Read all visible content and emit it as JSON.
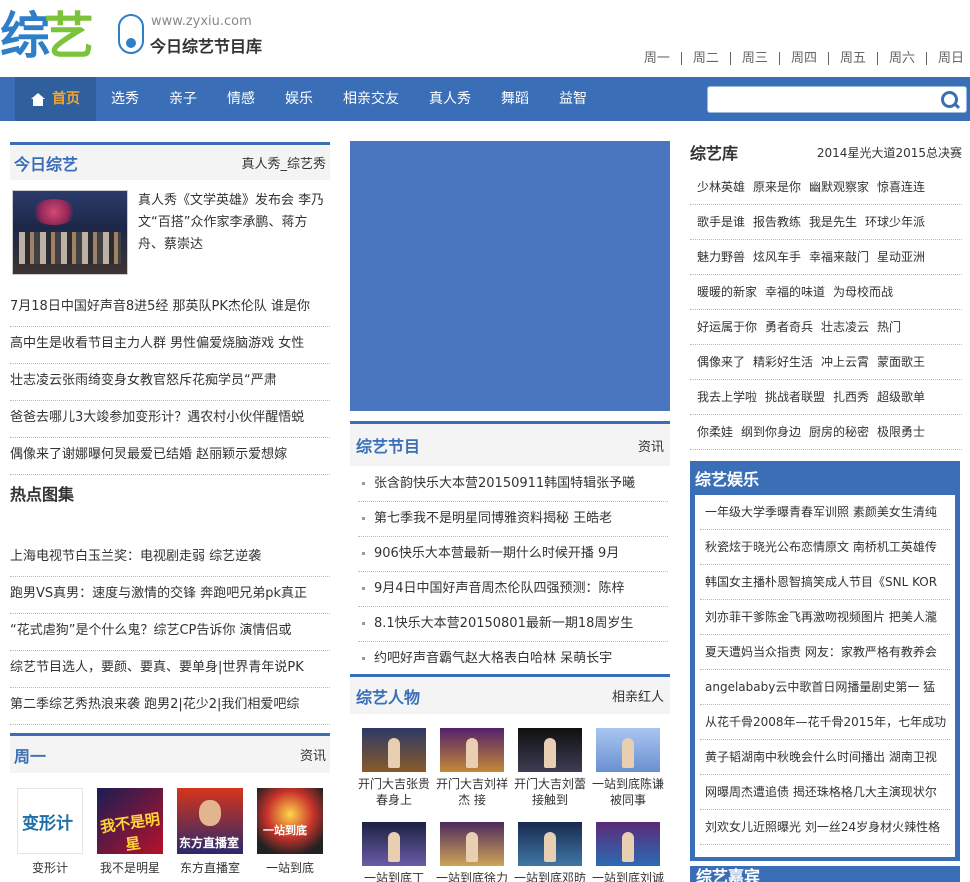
{
  "header": {
    "logo_text_1": "综",
    "logo_text_2": "艺",
    "url": "www.zyxiu.com",
    "site_name": "今日综艺节目库",
    "weekdays": [
      "周一",
      "周二",
      "周三",
      "周四",
      "周五",
      "周六",
      "周日"
    ]
  },
  "nav": {
    "home": "首页",
    "items": [
      "选秀",
      "亲子",
      "情感",
      "娱乐",
      "相亲交友",
      "真人秀",
      "舞蹈",
      "益智"
    ],
    "search_placeholder": ""
  },
  "today": {
    "title": "今日综艺",
    "more": "真人秀_综艺秀",
    "feature_text": "真人秀《文学英雄》发布会 李乃文“百搭”众作家李承鹏、蒋方舟、蔡崇达",
    "news": [
      "7月18日中国好声音8进5经 那英队PK杰伦队 谁是你",
      "高中生是收看节目主力人群 男性偏爱烧脑游戏 女性",
      "壮志凌云张雨绮变身女教官怒斥花痴学员“严肃",
      "爸爸去哪儿3大竣参加变形计？遇农村小伙伴醒悟蜕",
      "偶像来了谢娜曝何炅最爱已结婚 赵丽颖示爱想嫁"
    ]
  },
  "hot": {
    "title": "热点图集",
    "items": [
      "上海电视节白玉兰奖：电视剧走弱 综艺逆袭",
      "跑男VS真男：速度与激情的交锋 奔跑吧兄弟pk真正",
      "“花式虐狗”是个什么鬼？综艺CP告诉你 演情侣或",
      "综艺节目选人，要颜、要真、要单身|世界青年说PK",
      "第二季综艺秀热浪来袭 跑男2|花少2|我们相爱吧综"
    ]
  },
  "monday": {
    "title": "周一",
    "more": "资讯",
    "shows": [
      {
        "name": "变形计",
        "thumb_text": "变形计"
      },
      {
        "name": "我不是明星",
        "thumb_text": "我不是明星"
      },
      {
        "name": "东方直播室",
        "thumb_text": "东方直播室"
      },
      {
        "name": "一站到底",
        "thumb_text": "一站到底"
      }
    ]
  },
  "programs": {
    "title": "综艺节目",
    "more": "资讯",
    "items": [
      "张含韵快乐大本营20150911韩国特辑张予曦",
      "第七季我不是明星同博雅资料揭秘 王皓老",
      "906快乐大本营最新一期什么时候开播 9月",
      "9月4日中国好声音周杰伦队四强预测：陈梓",
      "8.1快乐大本营20150801最新一期18周岁生",
      "约吧好声音霸气赵大格表白哈林 呆萌长宇"
    ]
  },
  "figures": {
    "title": "综艺人物",
    "more": "相亲红人",
    "people": [
      "开门大吉张贵春身上",
      "开门大吉刘祥杰 接",
      "开门大吉刘蕾接触到",
      "一站到底陈谦被同事",
      "一站到底丁",
      "一站到底徐力",
      "一站到底邓昉",
      "一站到底刘诚"
    ]
  },
  "library": {
    "title": "综艺库",
    "more": "2014星光大道2015总决赛",
    "rows": [
      [
        "少林英雄",
        "原来是你",
        "幽默观察家",
        "惊喜连连"
      ],
      [
        "歌手是谁",
        "报告教练",
        "我是先生",
        "环球少年派"
      ],
      [
        "魅力野兽",
        "炫风车手",
        "幸福来敲门",
        "星动亚洲"
      ],
      [
        "暖暖的新家",
        "幸福的味道",
        "为母校而战"
      ],
      [
        "好运属于你",
        "勇者奇兵",
        "壮志凌云",
        "热门"
      ],
      [
        "偶像来了",
        "精彩好生活",
        "冲上云霄",
        "蒙面歌王"
      ],
      [
        "我去上学啦",
        "挑战者联盟",
        "扎西秀",
        "超级歌单"
      ],
      [
        "你柔娃",
        "纲到你身边",
        "厨房的秘密",
        "极限勇士"
      ]
    ]
  },
  "entertainment": {
    "title": "综艺娱乐",
    "items": [
      "一年级大学季曝青春军训照 素颜美女生清纯",
      "秋瓷炫于晓光公布恋情原文 南桥机工英雄传",
      "韩国女主播朴恩智搞笑成人节目《SNL KOR",
      "刘亦菲干爹陈金飞再激吻视频图片 把美人瀧",
      "夏天遭妈当众指责 网友：家教严格有教养会",
      "angelababy云中歌首日网播量剧史第一 猛",
      "从花千骨2008年—花千骨2015年，七年成功",
      "黄子韬湖南中秋晚会什么时间播出 湖南卫视",
      "网曝周杰遭追债 揭还珠格格几大主演现状尔",
      "刘欢女儿近照曝光 刘一丝24岁身材火辣性格"
    ]
  },
  "guests": {
    "title": "综艺嘉宾"
  },
  "colors": {
    "brand_blue": "#3a6fb8",
    "home_active": "#f3a531",
    "logo_green": "#7cc23a"
  }
}
